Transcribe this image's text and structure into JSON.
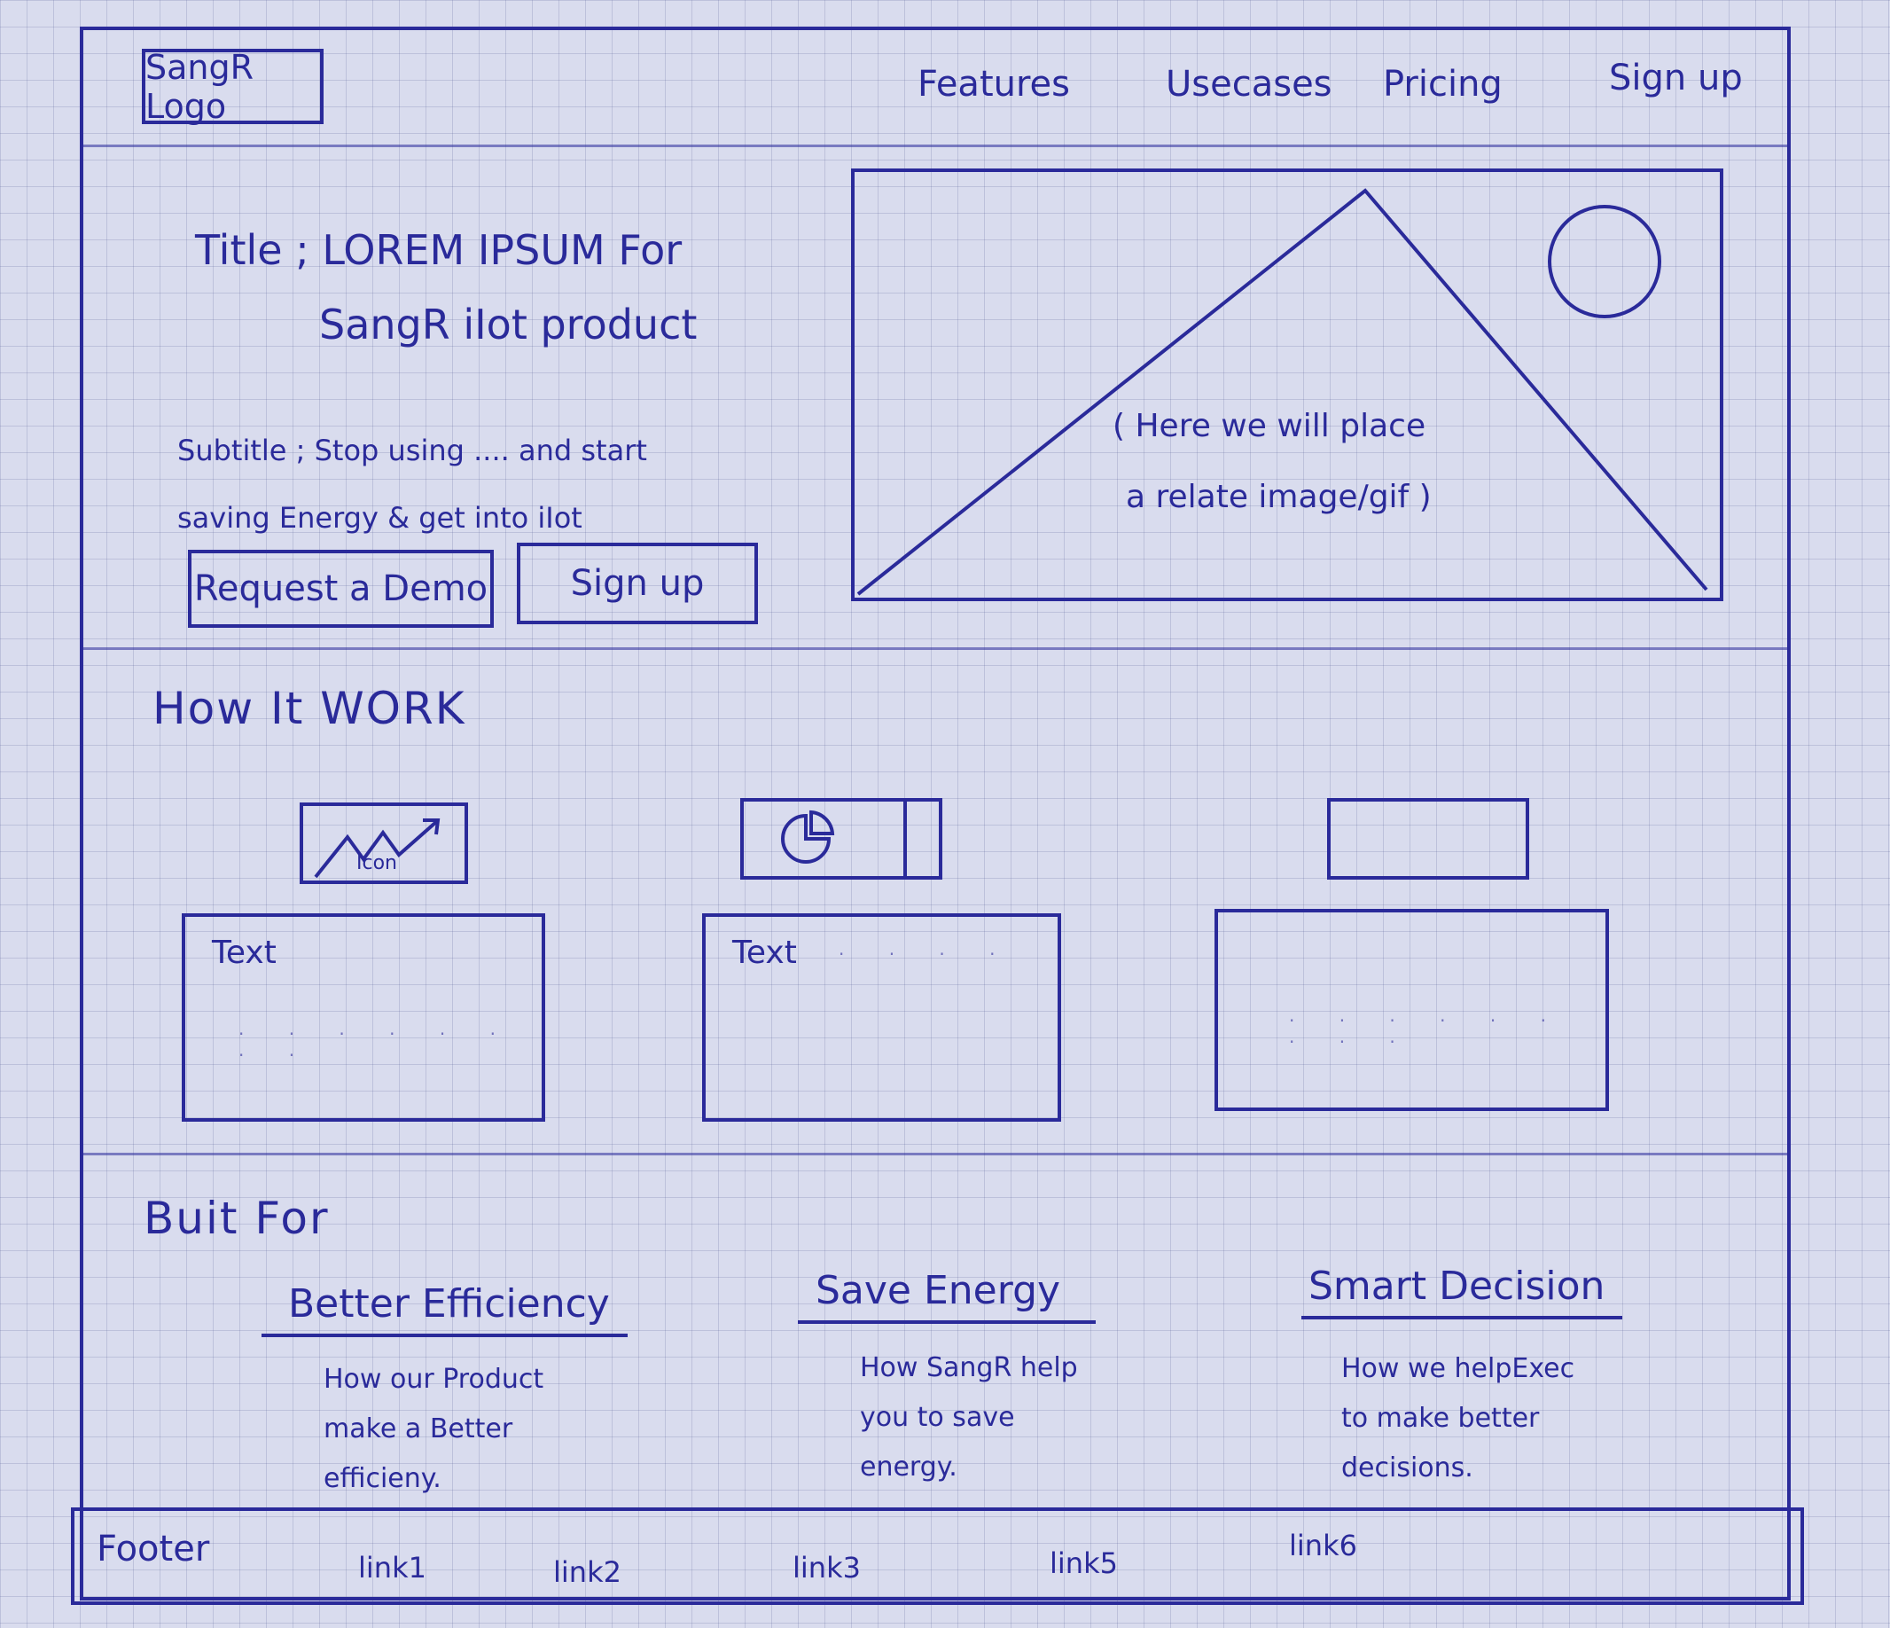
{
  "header": {
    "logo_text": "SangR Logo",
    "nav": [
      {
        "label": "Features"
      },
      {
        "label": "Usecases"
      },
      {
        "label": "Pricing"
      },
      {
        "label": "Sign up"
      }
    ]
  },
  "hero": {
    "title_line1": "Title ; LOREM IPSUM For",
    "title_line2": "SangR iIot product",
    "subtitle_line1": "Subtitle ; Stop using .... and start",
    "subtitle_line2": "saving Energy & get into iIot",
    "buttons": {
      "request_demo": "Request a Demo",
      "sign_up": "Sign up"
    },
    "image_note_line1": "( Here we will place",
    "image_note_line2": "a relate image/gif )"
  },
  "how_it_works": {
    "heading": "How It WORK",
    "icon_label": "Icon",
    "cards": [
      {
        "text": "Text"
      },
      {
        "text": "Text"
      },
      {
        "text": ""
      }
    ]
  },
  "built_for": {
    "heading": "Buit For",
    "features": [
      {
        "title": "Better Efficiency",
        "desc_line1": "How our Product",
        "desc_line2": "make a Better",
        "desc_line3": "efficieny."
      },
      {
        "title": "Save Energy",
        "desc_line1": "How SangR help",
        "desc_line2": "you to save",
        "desc_line3": "energy."
      },
      {
        "title": "Smart Decision",
        "desc_line1": "How we helpExec",
        "desc_line2": "to make better",
        "desc_line3": "decisions."
      }
    ]
  },
  "footer": {
    "title": "Footer",
    "links": [
      {
        "label": "link1"
      },
      {
        "label": "link2"
      },
      {
        "label": "link3"
      },
      {
        "label": "link5"
      },
      {
        "label": "link6"
      }
    ]
  }
}
